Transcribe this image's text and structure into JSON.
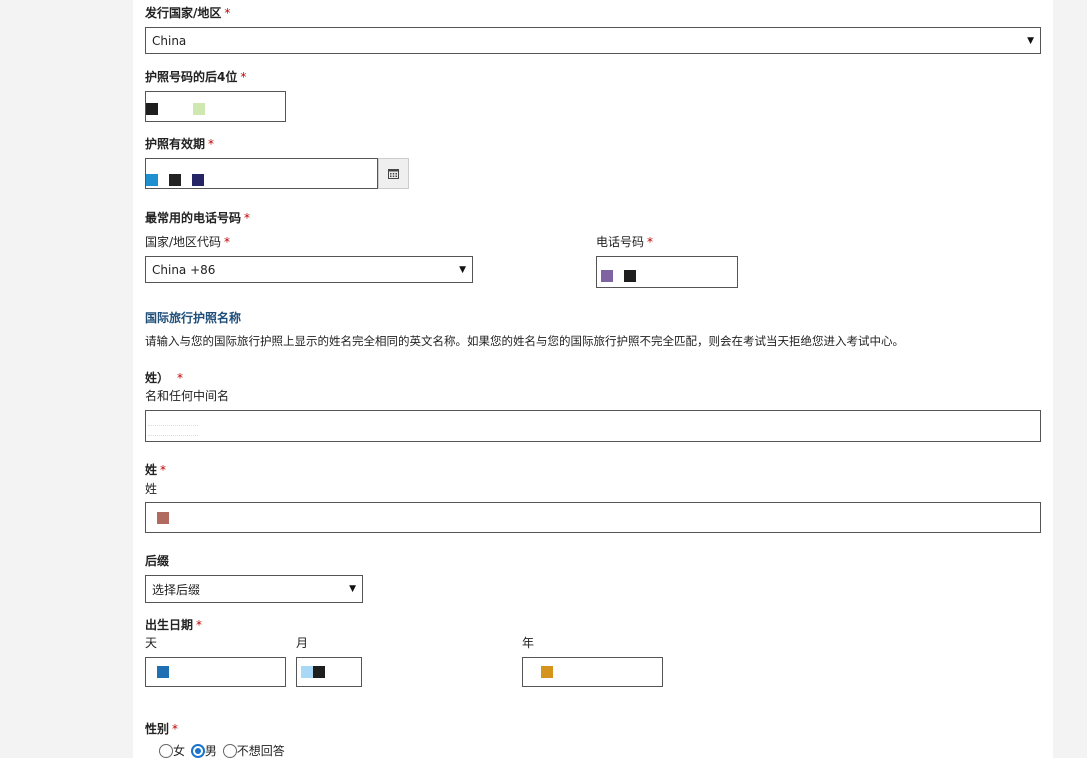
{
  "form": {
    "issuing_country": {
      "label": "发行国家/地区",
      "required": "*",
      "value": "China"
    },
    "passport_last4": {
      "label": "护照号码的后4位",
      "required": "*"
    },
    "passport_expiry": {
      "label": "护照有效期",
      "required": "*",
      "calendar_icon": "calendar-icon"
    },
    "phone": {
      "label": "最常用的电话号码",
      "required": "*",
      "country_code_label": "国家/地区代码",
      "country_code_value": "China +86",
      "number_label": "电话号码"
    },
    "intl_name": {
      "title": "国际旅行护照名称",
      "instruction": "请输入与您的国际旅行护照上显示的姓名完全相同的英文名称。如果您的姓名与您的国际旅行护照不完全匹配，则会在考试当天拒绝您进入考试中心。"
    },
    "given_name": {
      "label": "姓）",
      "required": "*",
      "sub": "名和任何中间名"
    },
    "surname": {
      "label": "姓",
      "required": "*",
      "sub": "姓"
    },
    "suffix": {
      "label": "后缀",
      "value": "选择后缀"
    },
    "birth_date": {
      "label": "出生日期",
      "required": "*",
      "day": "天",
      "month": "月",
      "year": "年"
    },
    "gender": {
      "label": "性别",
      "required": "*",
      "options": [
        "女",
        "男",
        "不想回答"
      ],
      "selected": "男"
    }
  },
  "colors": {
    "panel_bg": "#ffffff",
    "page_bg": "#f3f3f3",
    "required_star": "#c00000",
    "section_title": "#1f4e79",
    "radio_selected": "#1a73c9"
  }
}
